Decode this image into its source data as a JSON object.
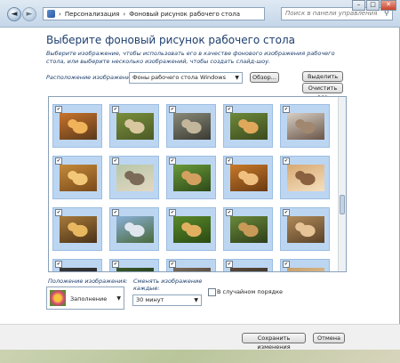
{
  "window": {
    "breadcrumb": [
      "Персонализация",
      "Фоновый рисунок рабочего стола"
    ],
    "search_placeholder": "Поиск в панели управления"
  },
  "page": {
    "title": "Выберите фоновый рисунок рабочего стола",
    "description": "Выберите изображение, чтобы использовать его в качестве фонового изображения рабочего стола, или выберите несколько изображений, чтобы создать слайд-шоу.",
    "location_label": "Расположение изображения:",
    "location_value": "Фоны рабочего стола Windows",
    "browse_label": "Обзор...",
    "select_all_label": "Выделить все",
    "clear_all_label": "Очистить все"
  },
  "gallery": {
    "tiles": [
      {
        "checked": true
      },
      {
        "checked": true
      },
      {
        "checked": true
      },
      {
        "checked": true
      },
      {
        "checked": true
      },
      {
        "checked": true
      },
      {
        "checked": true
      },
      {
        "checked": true
      },
      {
        "checked": true
      },
      {
        "checked": true
      },
      {
        "checked": true
      },
      {
        "checked": true
      },
      {
        "checked": true
      },
      {
        "checked": true
      },
      {
        "checked": true
      },
      {
        "checked": true
      },
      {
        "checked": true
      },
      {
        "checked": true
      },
      {
        "checked": true
      },
      {
        "checked": true
      }
    ]
  },
  "options": {
    "position_label": "Положение изображения:",
    "position_value": "Заполнение",
    "interval_label_line1": "Сменять изображение",
    "interval_label_line2": "каждые:",
    "interval_value": "30 минут",
    "shuffle_label": "В случайном порядке"
  },
  "footer": {
    "save_label": "Сохранить изменения",
    "cancel_label": "Отмена"
  },
  "colors": {
    "title": "#1e3f6e",
    "tile_selected": "#bcd6f2"
  }
}
